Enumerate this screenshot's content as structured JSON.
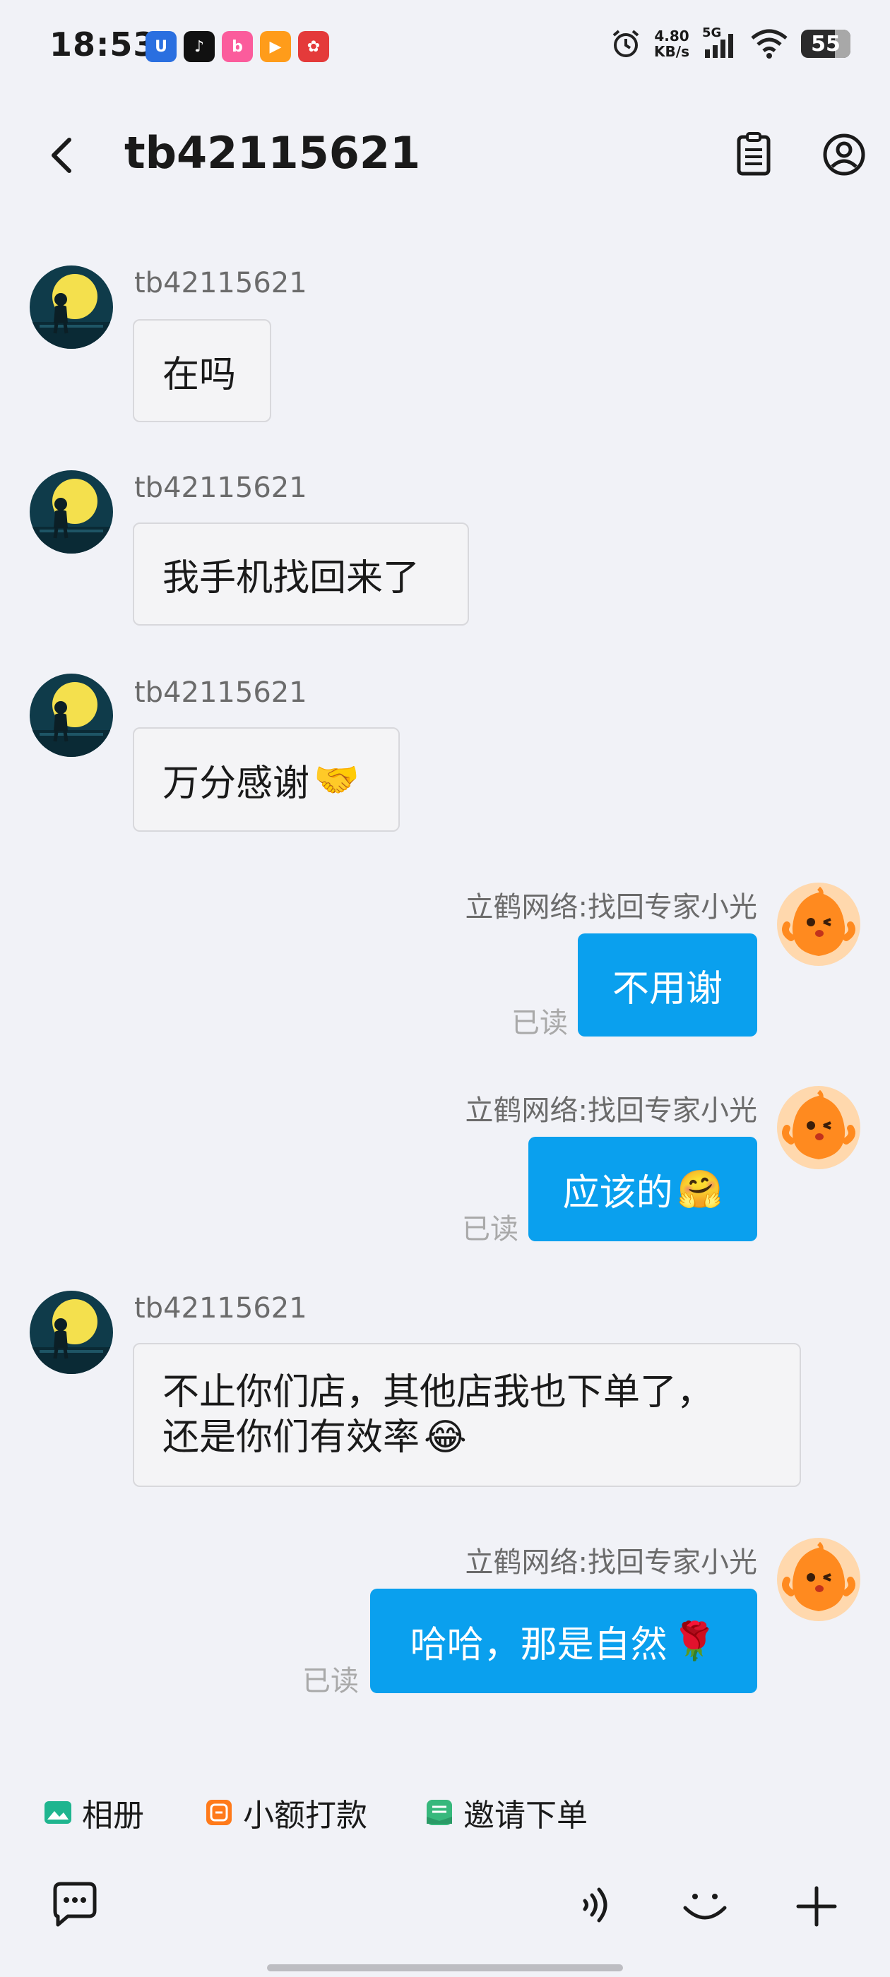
{
  "status_bar": {
    "time": "18:53",
    "net_speed_value": "4.80",
    "net_speed_unit": "KB/s",
    "network": "5G",
    "battery": "55"
  },
  "header": {
    "title": "tb42115621"
  },
  "messages": [
    {
      "sender": "tb42115621",
      "text": "在吗",
      "direction": "in"
    },
    {
      "sender": "tb42115621",
      "text": "我手机找回来了",
      "direction": "in"
    },
    {
      "sender": "tb42115621",
      "text": "万分感谢",
      "emoji": "🤝",
      "direction": "in"
    },
    {
      "sender": "立鹤网络:找回专家小光",
      "text": "不用谢",
      "status": "已读",
      "direction": "out"
    },
    {
      "sender": "立鹤网络:找回专家小光",
      "text": "应该的",
      "emoji": "🤗",
      "status": "已读",
      "direction": "out"
    },
    {
      "sender": "tb42115621",
      "line1": "不止你们店，其他店我也下单了，",
      "line2": "还是你们有效率",
      "emoji": "😂",
      "direction": "in"
    },
    {
      "sender": "立鹤网络:找回专家小光",
      "text": "哈哈，那是自然",
      "emoji": "🌹",
      "status": "已读",
      "direction": "out"
    }
  ],
  "quick_actions": [
    {
      "label": "相册",
      "icon": "photo-album-icon",
      "color": "#1fb58f"
    },
    {
      "label": "小额打款",
      "icon": "transfer-icon",
      "color": "#ff7a1a"
    },
    {
      "label": "邀请下单",
      "icon": "invite-order-icon",
      "color": "#37b87c"
    }
  ],
  "colors": {
    "accent": "#0aa0ee",
    "background": "#f1f2f7"
  }
}
